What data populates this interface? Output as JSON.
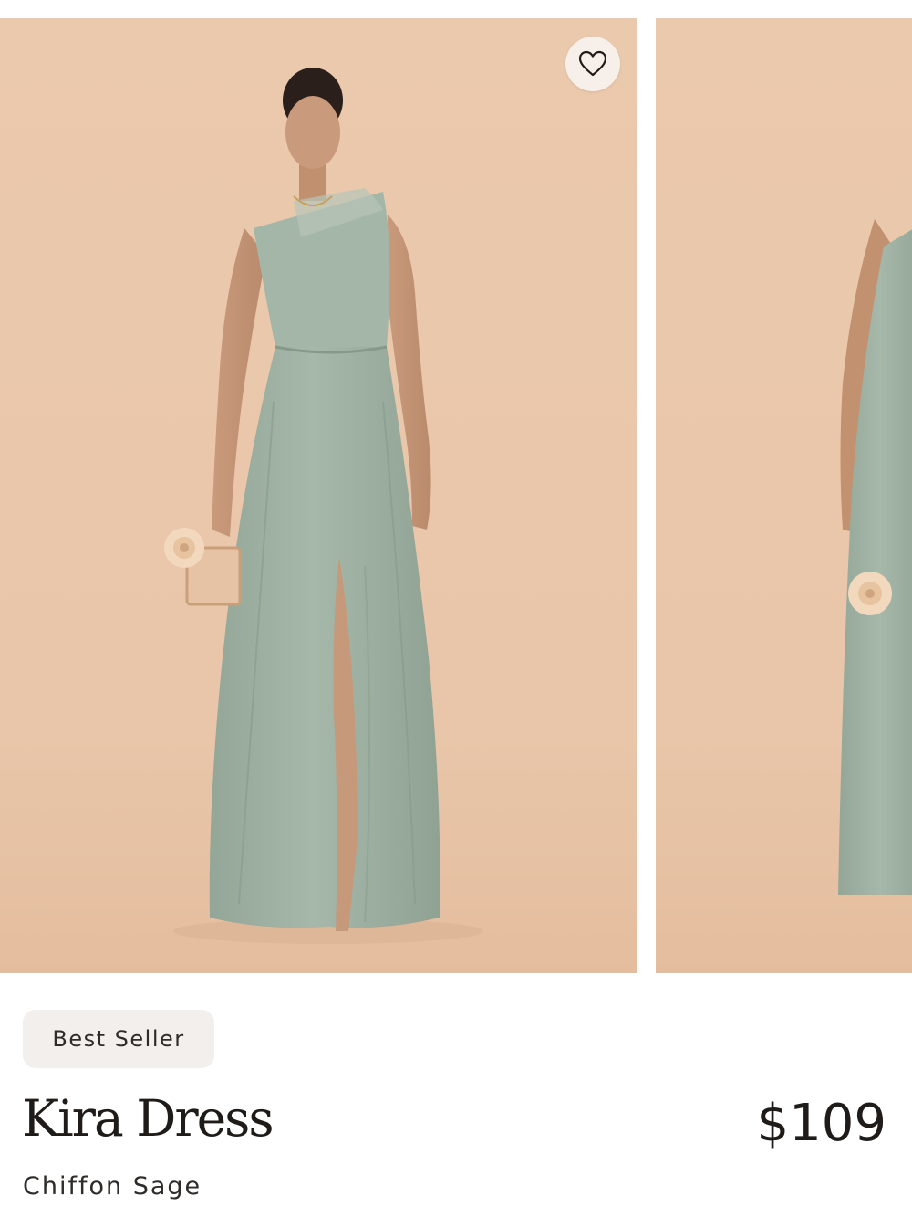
{
  "carousel": {
    "background_color": "#eac8ab",
    "images": [
      {
        "subject": "model wearing one-shoulder sage chiffon gown holding clutch and flower"
      },
      {
        "subject": "second view of sage gown, partially visible"
      }
    ]
  },
  "favorite": {
    "icon": "heart-outline-icon"
  },
  "product": {
    "badge": "Best Seller",
    "name": "Kira Dress",
    "price": "$109",
    "variant": "Chiffon Sage"
  },
  "colors": {
    "dress": "#9eb0a2",
    "text": "#1f1b18",
    "badge_bg": "#f2efec"
  }
}
